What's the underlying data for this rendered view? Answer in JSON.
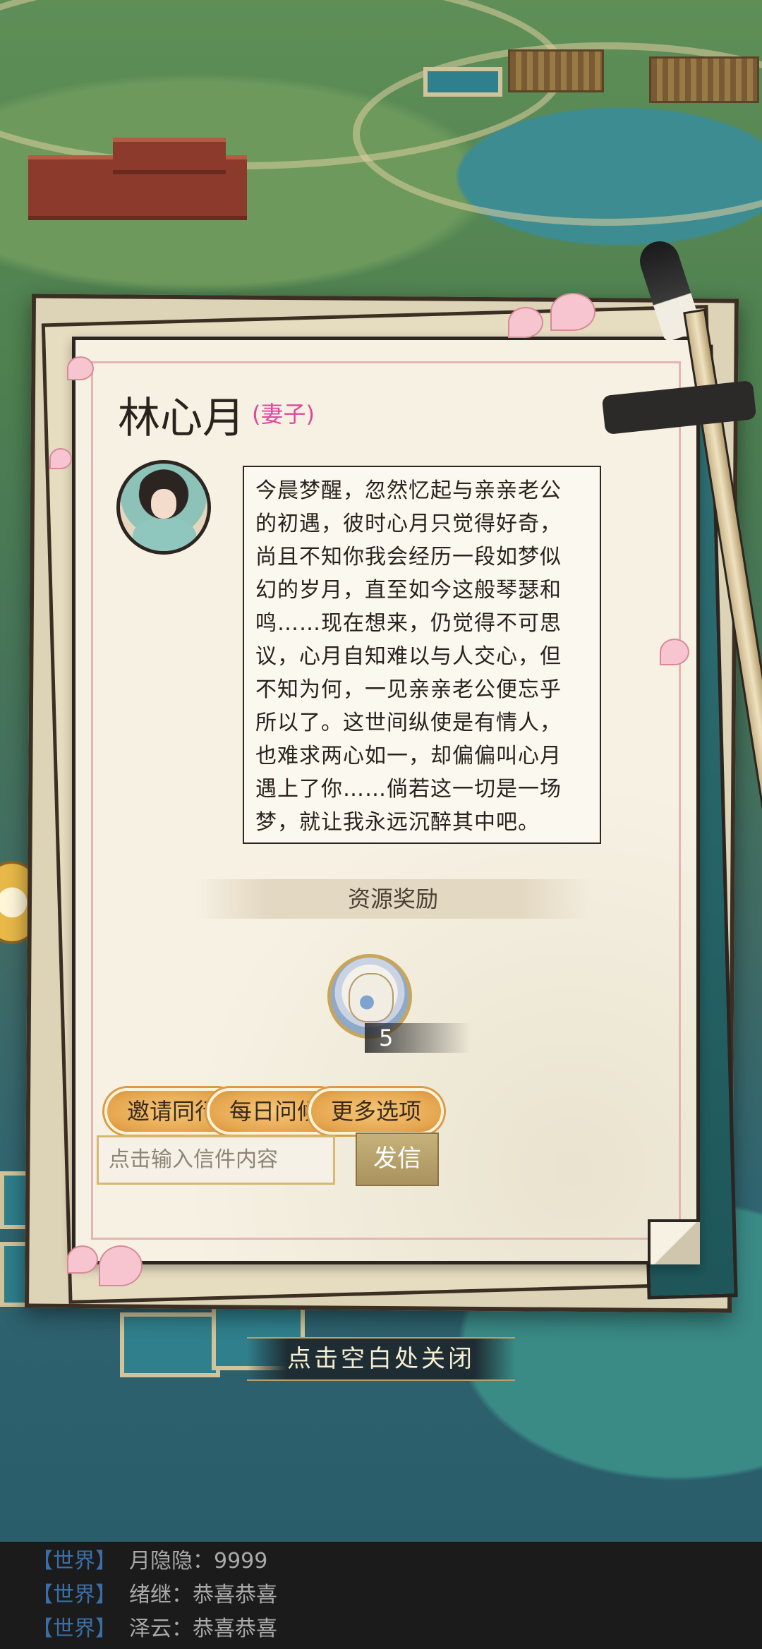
{
  "letter": {
    "name": "林心月",
    "relation": "(妻子)",
    "message_lines": [
      "今晨梦醒，忽然忆起与亲亲老公",
      "的初遇，彼时心月只觉得好奇，",
      "尚且不知你我会经历一段如梦似",
      "幻的岁月，直至如今这般琴瑟和",
      "鸣……现在想来，仍觉得不可思",
      "议，心月自知难以与人交心，但",
      "不知为何，一见亲亲老公便忘乎",
      "所以了。这世间纵使是有情人，",
      "也难求两心如一，却偏偏叫心月",
      "遇上了你……倘若这一切是一场",
      "梦，就让我永远沉醉其中吧。"
    ],
    "reward_title": "资源奖励",
    "reward": {
      "icon": "pouch-icon",
      "count": "5"
    },
    "buttons": [
      "邀请同行",
      "每日问候",
      "更多选项"
    ],
    "input_placeholder": "点击输入信件内容",
    "send_label": "发信"
  },
  "close_hint": "点击空白处关闭",
  "chat": [
    {
      "channel": "【世界】",
      "text": "月隐隐：9999"
    },
    {
      "channel": "【世界】",
      "text": "绪继：恭喜恭喜"
    },
    {
      "channel": "【世界】",
      "text": "泽云：恭喜恭喜"
    }
  ],
  "colors": {
    "relation": "#e0479c",
    "button_gold": "#e6a64f",
    "chat_channel": "#3b6ea6"
  }
}
